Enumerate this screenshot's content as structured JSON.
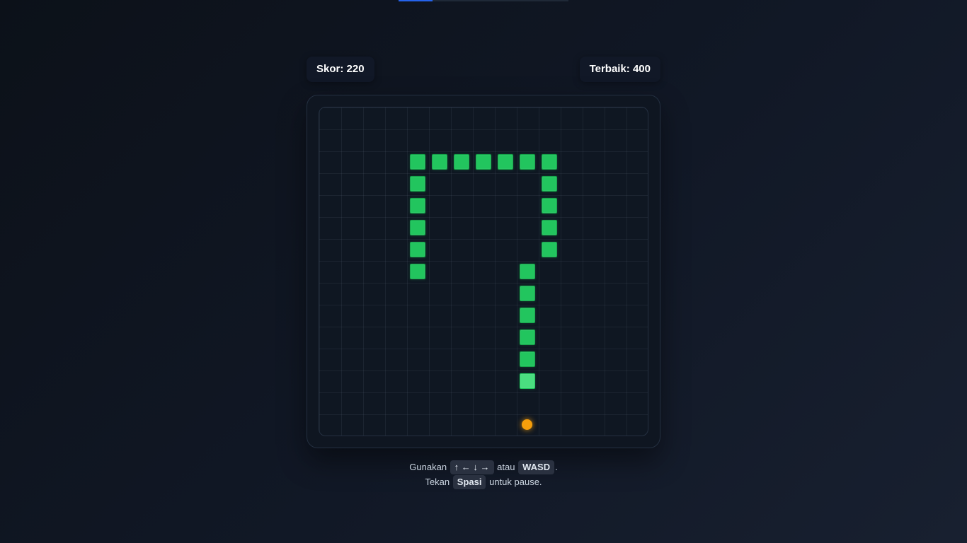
{
  "progress": {
    "fraction": 0.2
  },
  "score": {
    "label": "Skor: 220",
    "value": 220
  },
  "best": {
    "label": "Terbaik: 400",
    "value": 400
  },
  "game": {
    "grid_size": 15,
    "snake": [
      [
        9,
        12
      ],
      [
        9,
        11
      ],
      [
        9,
        10
      ],
      [
        9,
        9
      ],
      [
        9,
        8
      ],
      [
        9,
        7
      ],
      [
        10,
        6
      ],
      [
        10,
        5
      ],
      [
        10,
        4
      ],
      [
        10,
        3
      ],
      [
        10,
        2
      ],
      [
        9,
        2
      ],
      [
        8,
        2
      ],
      [
        7,
        2
      ],
      [
        6,
        2
      ],
      [
        5,
        2
      ],
      [
        4,
        2
      ],
      [
        4,
        3
      ],
      [
        4,
        4
      ],
      [
        4,
        5
      ],
      [
        4,
        6
      ],
      [
        4,
        7
      ]
    ],
    "food": [
      9,
      14
    ],
    "colors": {
      "snake": "#22c55e",
      "snake_head": "#4ade80",
      "food": "#f59e0b"
    }
  },
  "instructions": {
    "line1": {
      "prefix": "Gunakan",
      "keys_arrows": "↑ ← ↓ →",
      "middle": "atau",
      "keys_wasd": "WASD",
      "suffix": "."
    },
    "line2": {
      "prefix": "Tekan",
      "key_space": "Spasi",
      "suffix": "untuk pause."
    }
  }
}
